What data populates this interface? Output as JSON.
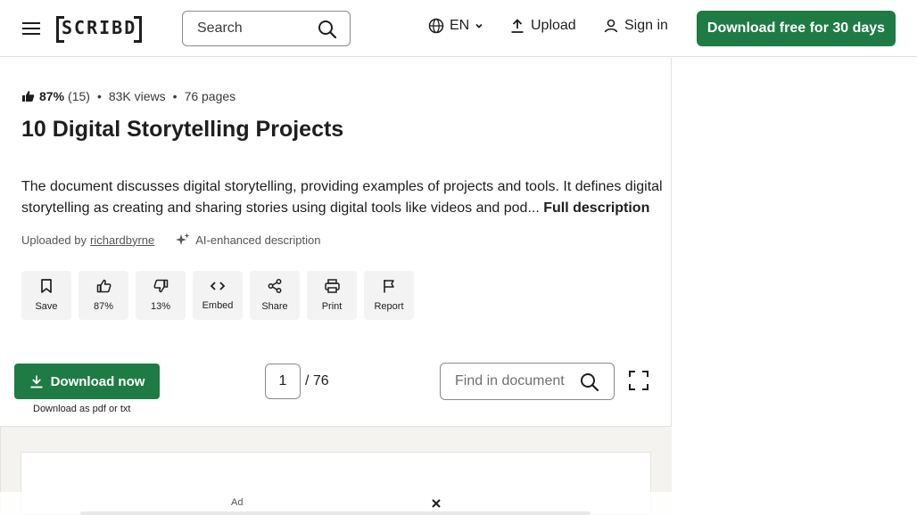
{
  "header": {
    "logo_text": "SCRIBD",
    "search_placeholder": "Search",
    "language": "EN",
    "upload_label": "Upload",
    "signin_label": "Sign in",
    "cta_label": "Download free for 30 days"
  },
  "document": {
    "rating": "87%",
    "rating_count": "(15)",
    "views": "83K views",
    "pages": "76 pages",
    "title": "10 Digital Storytelling Projects",
    "description": "The document discusses digital storytelling, providing examples of projects and tools. It defines digital storytelling as creating and sharing stories using digital tools like videos and pod...",
    "full_description_link": "Full description",
    "uploaded_by_prefix": "Uploaded by",
    "uploader": "richardbyrne",
    "ai_label": "AI-enhanced description"
  },
  "actions": {
    "save": "Save",
    "like": "87%",
    "dislike": "13%",
    "embed": "Embed",
    "share": "Share",
    "print": "Print",
    "report": "Report"
  },
  "toolbar": {
    "download_label": "Download now",
    "download_sub": "Download as pdf or txt",
    "page_current": "1",
    "page_total": "/ 76",
    "find_placeholder": "Find in document"
  },
  "ad": {
    "label": "Ad"
  },
  "colors": {
    "brand_green": "#1e7b44",
    "text": "#1e1e1e",
    "viewer_bg": "#f5f3f0"
  }
}
